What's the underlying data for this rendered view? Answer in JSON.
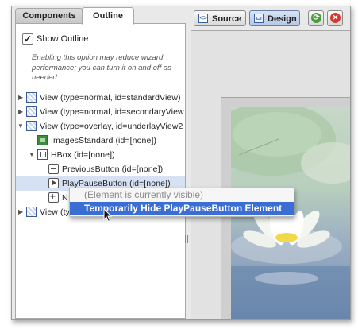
{
  "tabs": {
    "components": "Components",
    "outline": "Outline"
  },
  "outline": {
    "show_outline_label": "Show Outline",
    "show_outline_checked": true,
    "hint": "Enabling this option may reduce wizard performance; you can turn it on and off as needed."
  },
  "tree": {
    "nodes": [
      {
        "label": "View (type=normal, id=standardView)",
        "icon": "view-icon",
        "expand": "collapsed"
      },
      {
        "label": "View (type=normal, id=secondaryView",
        "icon": "view-icon",
        "expand": "collapsed"
      },
      {
        "label": "View (type=overlay, id=underlayView2",
        "icon": "view-icon",
        "expand": "expanded"
      },
      {
        "label": "ImagesStandard (id=[none])",
        "icon": "images-icon",
        "expand": "none"
      },
      {
        "label": "HBox (id=[none])",
        "icon": "hbox-icon",
        "expand": "expanded"
      },
      {
        "label": "PreviousButton (id=[none])",
        "icon": "button-icon",
        "expand": "none"
      },
      {
        "label": "PlayPauseButton (id=[none])",
        "icon": "play-icon",
        "expand": "none",
        "selected": true
      },
      {
        "label": "N",
        "icon": "add-icon",
        "expand": "none"
      },
      {
        "label": "View (ty",
        "icon": "view-icon",
        "expand": "collapsed"
      }
    ]
  },
  "toolbar": {
    "source_label": "Source",
    "design_label": "Design",
    "source_icon": "source-code-icon",
    "design_icon": "design-view-icon",
    "refresh_icon": "refresh-icon",
    "stop_icon": "stop-icon"
  },
  "context_menu": {
    "status": "(Element is currently visible)",
    "action": "Temporarily Hide PlayPauseButton Element"
  },
  "colors": {
    "menu_highlight": "#3b6ed4",
    "selection": "#d6e2f3"
  }
}
